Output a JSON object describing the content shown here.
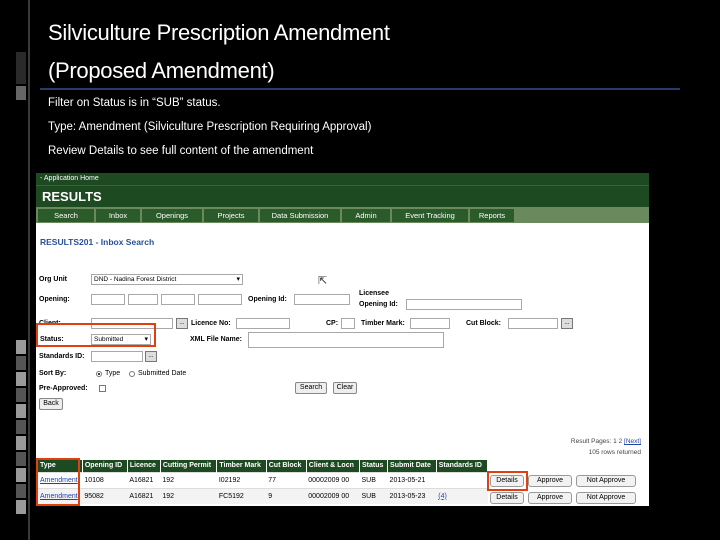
{
  "slide": {
    "title_line1": "Silviculture Prescription Amendment",
    "title_line2": "(Proposed Amendment)",
    "bullets": [
      "Filter on Status is in “SUB” status.",
      "Type: Amendment (Silviculture Prescription Requiring Approval)",
      "Review Details to see full content of the amendment"
    ]
  },
  "app": {
    "top_link": "- Application Home",
    "brand": "RESULTS",
    "nav": [
      "Search",
      "Inbox",
      "Openings",
      "Projects",
      "Data Submission",
      "Admin",
      "Event Tracking",
      "Reports"
    ],
    "page_title": "RESULTS201 - Inbox Search"
  },
  "form": {
    "org_unit_label": "Org Unit",
    "org_unit_value": "DND - Nadina Forest District",
    "openings_label": "Opening:",
    "opening_id_label": "Opening Id:",
    "licensee_label": "Licensee",
    "licensee_opening_id_label": "Opening Id:",
    "cutom_label": "Client:",
    "licence_no_label": "Licence No:",
    "cp_label": "CP:",
    "timber_mark_label": "Timber Mark:",
    "cut_block_label": "Cut Block:",
    "status_label": "Status:",
    "status_value": "Submitted",
    "xml_file_label": "XML File Name:",
    "standards_id_label": "Standards ID:",
    "sort_by_label": "Sort By:",
    "sort_option_1": "Type",
    "sort_option_2": "Submitted Date",
    "pre_approved_label": "Pre-Approved:",
    "search_button": "Search",
    "clear_button": "Clear",
    "back_button": "Back",
    "dots": "..."
  },
  "results": {
    "pages_text": "Result Pages: 1 2",
    "next_text": "[Next]",
    "rows_text": "105 rows returned",
    "columns": [
      "Type",
      "Opening ID",
      "Licence",
      "Cutting Permit",
      "Timber Mark",
      "Cut Block",
      "Client & Locn",
      "Status",
      "Submit Date",
      "Standards ID"
    ],
    "rows": [
      [
        "Amendment",
        "10108",
        "A16821",
        "192",
        "I02192",
        "77",
        "00002009 00",
        "SUB",
        "2013-05-21",
        ""
      ],
      [
        "Amendment",
        "95082",
        "A16821",
        "192",
        "FC5192",
        "9",
        "00002009 00",
        "SUB",
        "2013-05-23",
        "(4)"
      ]
    ],
    "details_label": "Details",
    "approve_label": "Approve",
    "not_approve_label": "Not Approve"
  }
}
